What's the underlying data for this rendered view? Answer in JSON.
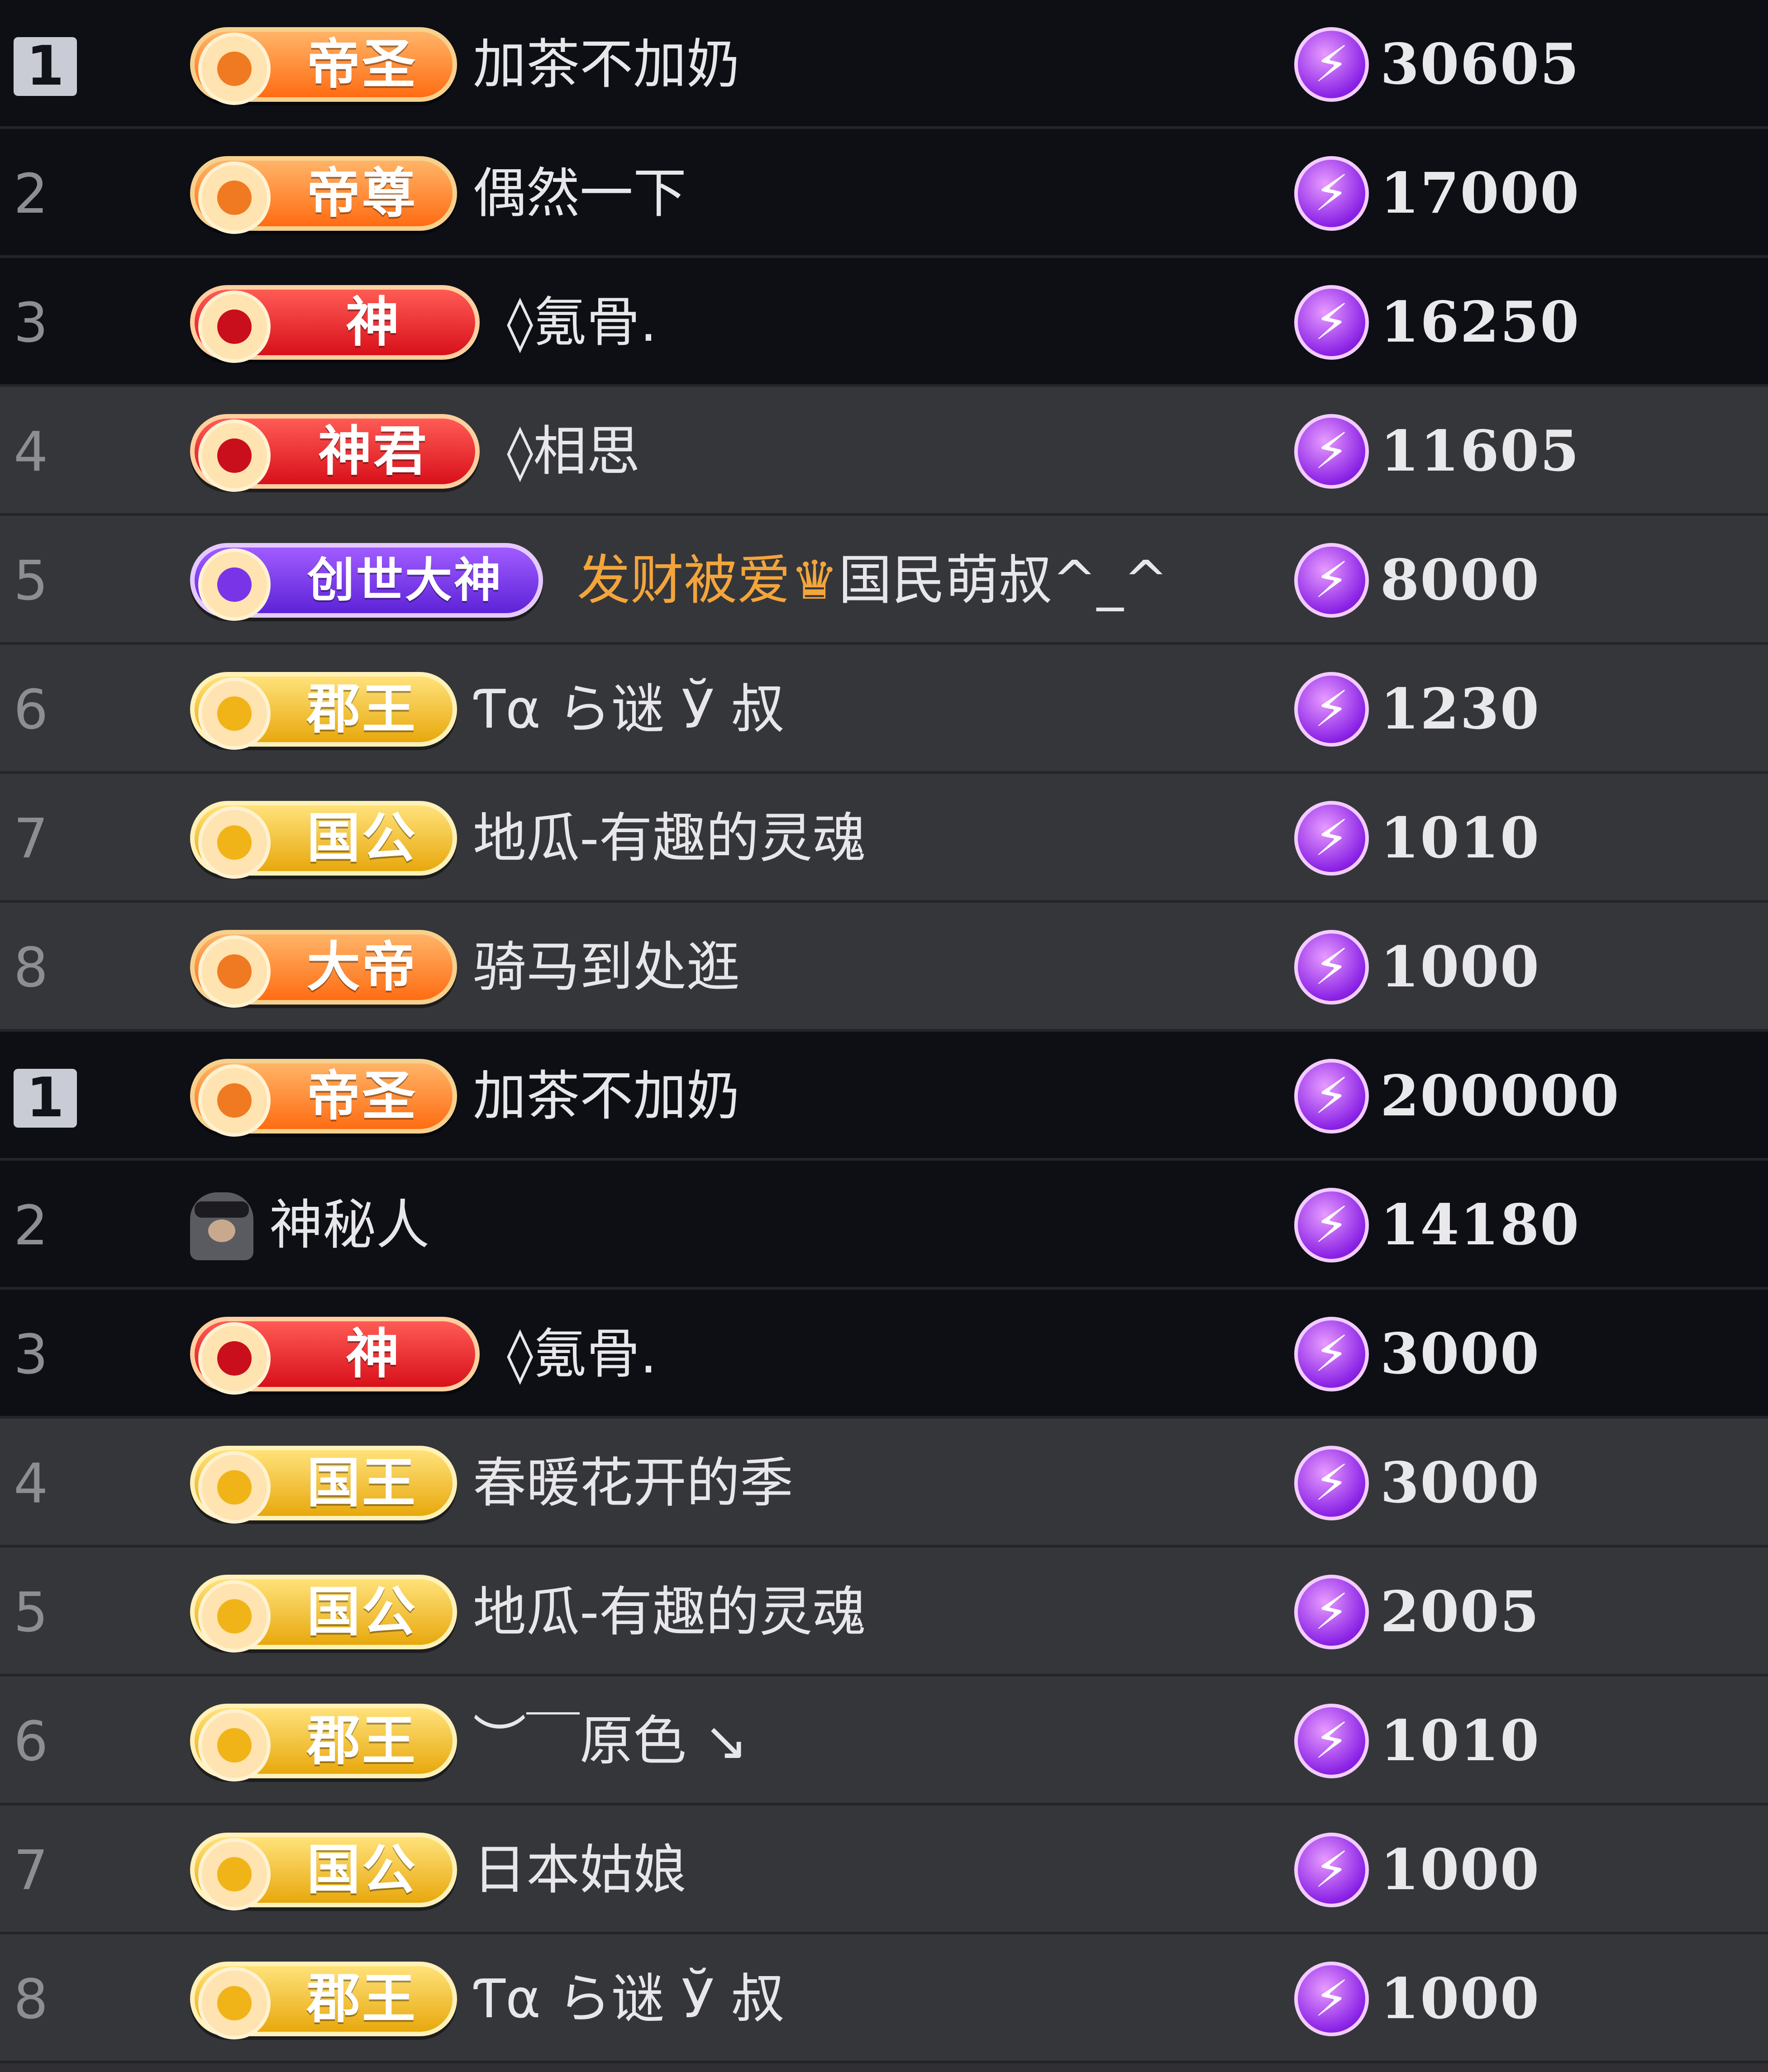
{
  "colors": {
    "dark_row": "#0d0f15",
    "grey_row": "#35363a",
    "coin_purple": "#8b23e6",
    "badge_orange": "#ff6c13",
    "badge_red": "#d8101a",
    "badge_purple": "#5d23d8",
    "badge_gold": "#e8a80d",
    "name_gold": "#f3a53b"
  },
  "lists": [
    {
      "rows": [
        {
          "rank": "1",
          "badge_text": "帝圣",
          "badge_style": "orange",
          "badge_icon": "emperor-medal-icon",
          "name": "加茶不加奶",
          "score": "30605",
          "theme": "dark"
        },
        {
          "rank": "2",
          "badge_text": "帝尊",
          "badge_style": "orange",
          "badge_icon": "emperor-medal-icon",
          "name": "偶然一下",
          "score": "17000",
          "theme": "dark"
        },
        {
          "rank": "3",
          "badge_text": "神",
          "badge_style": "red",
          "badge_icon": "god-medal-icon",
          "name": "◊氪骨.",
          "score": "16250",
          "theme": "dark"
        },
        {
          "rank": "4",
          "badge_text": "神君",
          "badge_style": "red",
          "badge_icon": "god-medal-icon",
          "name": "◊相思",
          "score": "11605",
          "theme": "grey"
        },
        {
          "rank": "5",
          "badge_text": "创世大神",
          "badge_style": "purple",
          "badge_icon": "creator-god-medal-icon",
          "name_prefix": "发财被爱",
          "name_icon": "crown-icon",
          "name": "国民萌叔^_^",
          "score": "8000",
          "theme": "grey"
        },
        {
          "rank": "6",
          "badge_text": "郡王",
          "badge_style": "gold",
          "badge_icon": "gold-medal-icon",
          "name": "Ƭα ら谜 Ў 叔",
          "score": "1230",
          "theme": "grey"
        },
        {
          "rank": "7",
          "badge_text": "国公",
          "badge_style": "gold",
          "badge_icon": "gold-medal-icon",
          "name": "地瓜-有趣的灵魂",
          "score": "1010",
          "theme": "grey"
        },
        {
          "rank": "8",
          "badge_text": "大帝",
          "badge_style": "orange",
          "badge_icon": "emperor-medal-icon",
          "name": "骑马到处逛",
          "score": "1000",
          "theme": "grey"
        }
      ]
    },
    {
      "rows": [
        {
          "rank": "1",
          "badge_text": "帝圣",
          "badge_style": "orange",
          "badge_icon": "emperor-medal-icon",
          "name": "加茶不加奶",
          "score": "200000",
          "theme": "dark"
        },
        {
          "rank": "2",
          "badge_text": "",
          "badge_style": "avatar",
          "badge_icon": "mystery-person-icon",
          "name": "神秘人",
          "score": "14180",
          "theme": "dark"
        },
        {
          "rank": "3",
          "badge_text": "神",
          "badge_style": "red",
          "badge_icon": "god-medal-icon",
          "name": "◊氪骨.",
          "score": "3000",
          "theme": "dark"
        },
        {
          "rank": "4",
          "badge_text": "国王",
          "badge_style": "gold",
          "badge_icon": "gold-medal-icon",
          "name": "春暖花开的季",
          "score": "3000",
          "theme": "grey"
        },
        {
          "rank": "5",
          "badge_text": "国公",
          "badge_style": "gold",
          "badge_icon": "gold-medal-icon",
          "name": "地瓜-有趣的灵魂",
          "score": "2005",
          "theme": "grey"
        },
        {
          "rank": "6",
          "badge_text": "郡王",
          "badge_style": "gold",
          "badge_icon": "gold-medal-icon",
          "name": "︶￣原色 ↘",
          "score": "1010",
          "theme": "grey"
        },
        {
          "rank": "7",
          "badge_text": "国公",
          "badge_style": "gold",
          "badge_icon": "gold-medal-icon",
          "name": "日本姑娘",
          "score": "1000",
          "theme": "grey"
        },
        {
          "rank": "8",
          "badge_text": "郡王",
          "badge_style": "gold",
          "badge_icon": "gold-medal-icon",
          "name": "Ƭα ら谜 Ў 叔",
          "score": "1000",
          "theme": "grey"
        }
      ]
    }
  ],
  "coin_glyph": "⚡",
  "coin_icon": "lightning-coin-icon"
}
